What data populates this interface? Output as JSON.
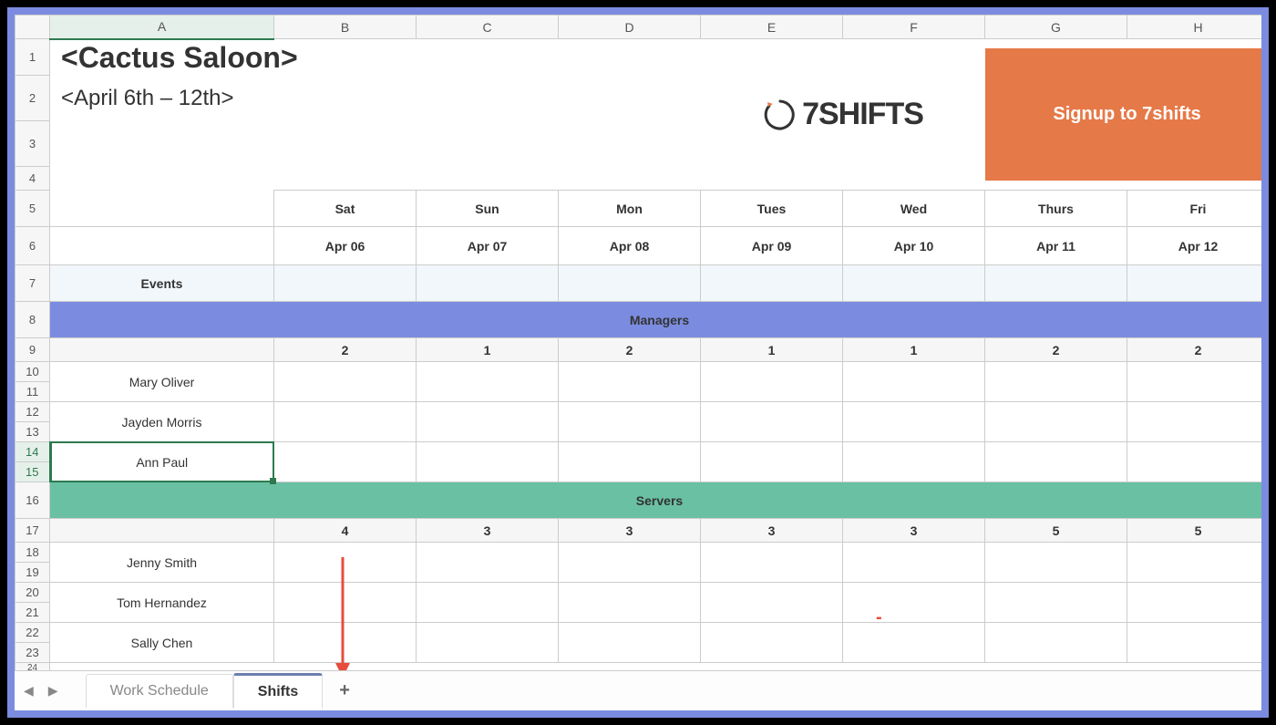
{
  "columns": [
    "A",
    "B",
    "C",
    "D",
    "E",
    "F",
    "G",
    "H"
  ],
  "title": "<Cactus Saloon>",
  "date_range": "<April 6th – 12th>",
  "logo_text": "7SHIFTS",
  "signup_label": "Signup to 7shifts",
  "days": [
    "Sat",
    "Sun",
    "Mon",
    "Tues",
    "Wed",
    "Thurs",
    "Fri"
  ],
  "dates": [
    "Apr 06",
    "Apr 07",
    "Apr 08",
    "Apr 09",
    "Apr 10",
    "Apr 11",
    "Apr 12"
  ],
  "events_label": "Events",
  "sections": {
    "managers": {
      "label": "Managers",
      "counts": [
        "2",
        "1",
        "2",
        "1",
        "1",
        "2",
        "2"
      ],
      "people": [
        "Mary Oliver",
        "Jayden Morris",
        "Ann Paul"
      ]
    },
    "servers": {
      "label": "Servers",
      "counts": [
        "4",
        "3",
        "3",
        "3",
        "3",
        "5",
        "5"
      ],
      "people": [
        "Jenny Smith",
        "Tom Hernandez",
        "Sally Chen"
      ]
    }
  },
  "tabs": {
    "work_schedule": "Work Schedule",
    "shifts": "Shifts",
    "add": "+"
  }
}
